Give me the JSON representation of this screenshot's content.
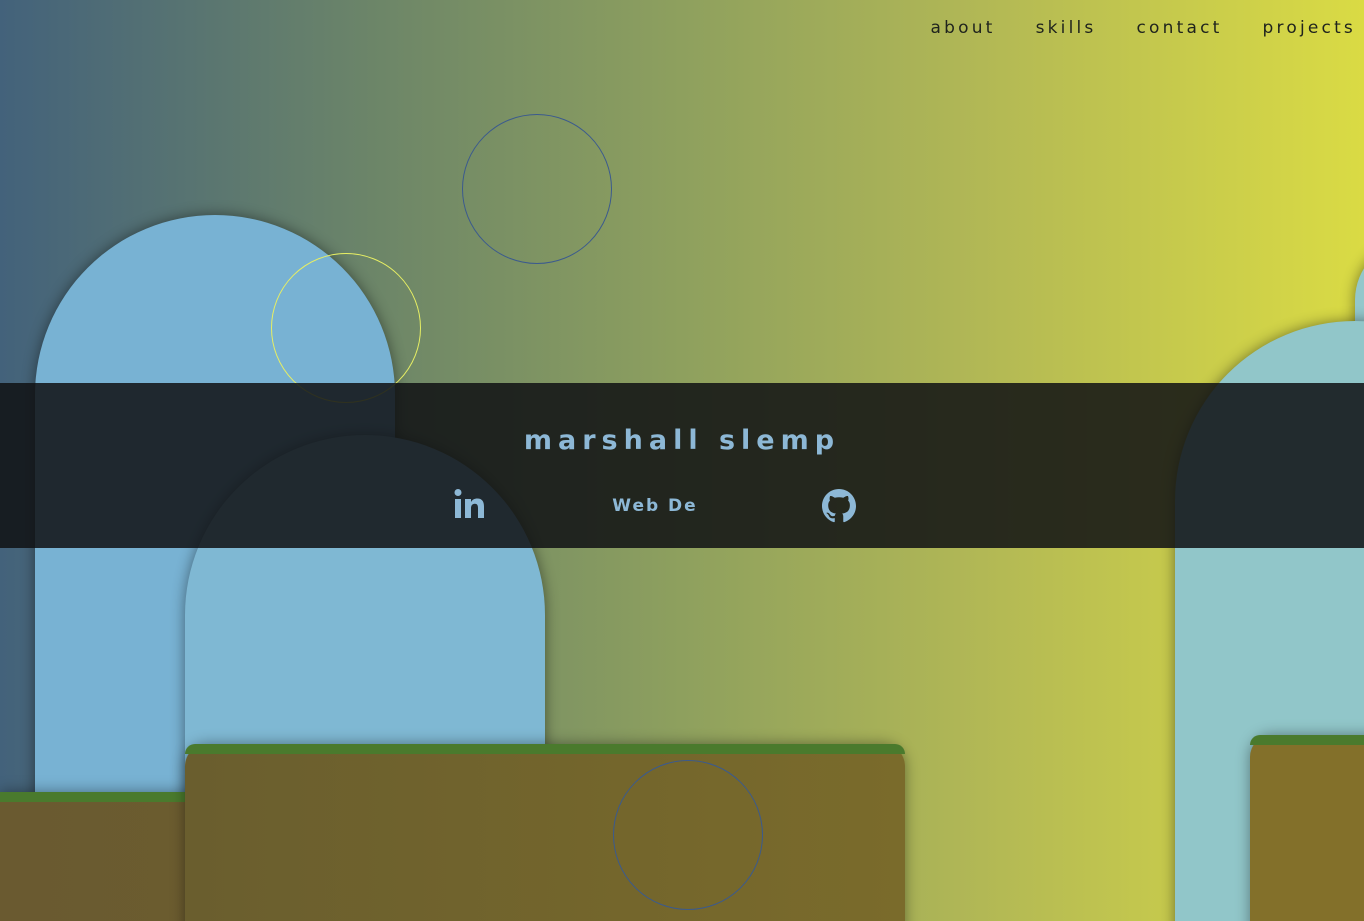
{
  "nav": {
    "items": [
      {
        "label": "about"
      },
      {
        "label": "skills"
      },
      {
        "label": "contact"
      },
      {
        "label": "projects"
      }
    ]
  },
  "hero": {
    "name": "marshall slemp",
    "subtitle": "Web De",
    "social": [
      {
        "icon": "linkedin-icon"
      },
      {
        "icon": "github-icon"
      }
    ]
  },
  "colors": {
    "gradient_start": "#43627b",
    "gradient_end": "#dadb44",
    "accent_text": "#8db8d6",
    "banner": "#101214",
    "arch_blue": "#78b2d3",
    "arch_teal": "#91c6c9",
    "ground_brown": "#6d5f2e",
    "grass_green": "#4a7a2d",
    "circle_outline": "#3b5a8e",
    "circle_yellow": "#e6ee64"
  }
}
